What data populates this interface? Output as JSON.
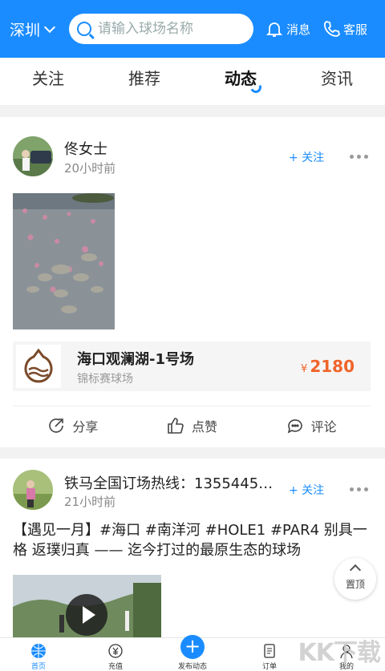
{
  "topbar": {
    "city": "深圳",
    "search_placeholder": "请输入球场名称",
    "message_label": "消息",
    "service_label": "客服",
    "colors": {
      "brand": "#1a8cff"
    }
  },
  "tabs": [
    {
      "label": "关注",
      "active": false
    },
    {
      "label": "推荐",
      "active": false
    },
    {
      "label": "动态",
      "active": true
    },
    {
      "label": "资讯",
      "active": false
    }
  ],
  "posts": [
    {
      "author": "佟女士",
      "time": "20小时前",
      "follow_label": "+ 关注",
      "course": {
        "name": "海口观澜湖-1号场",
        "type": "锦标赛球场",
        "currency": "¥",
        "price": "2180"
      },
      "actions": {
        "share": "分享",
        "like": "点赞",
        "comment": "评论"
      }
    },
    {
      "author": "铁马全国订场热线：1355445…",
      "time": "21小时前",
      "follow_label": "+ 关注",
      "text": "【遇见一月】#海口 #南洋河 #HOLE1 #PAR4 别具一格 返璞归真 —— 迄今打过的最原生态的球场"
    }
  ],
  "scroll_top_label": "置顶",
  "bottom_nav": [
    {
      "label": "首页",
      "icon": "home-globe-icon",
      "active": true
    },
    {
      "label": "充值",
      "icon": "recharge-icon",
      "active": false
    },
    {
      "label": "发布动态",
      "icon": "plus-icon",
      "active": false
    },
    {
      "label": "订单",
      "icon": "order-icon",
      "active": false
    },
    {
      "label": "我的",
      "icon": "person-icon",
      "active": false
    }
  ],
  "watermark": "KK下载"
}
